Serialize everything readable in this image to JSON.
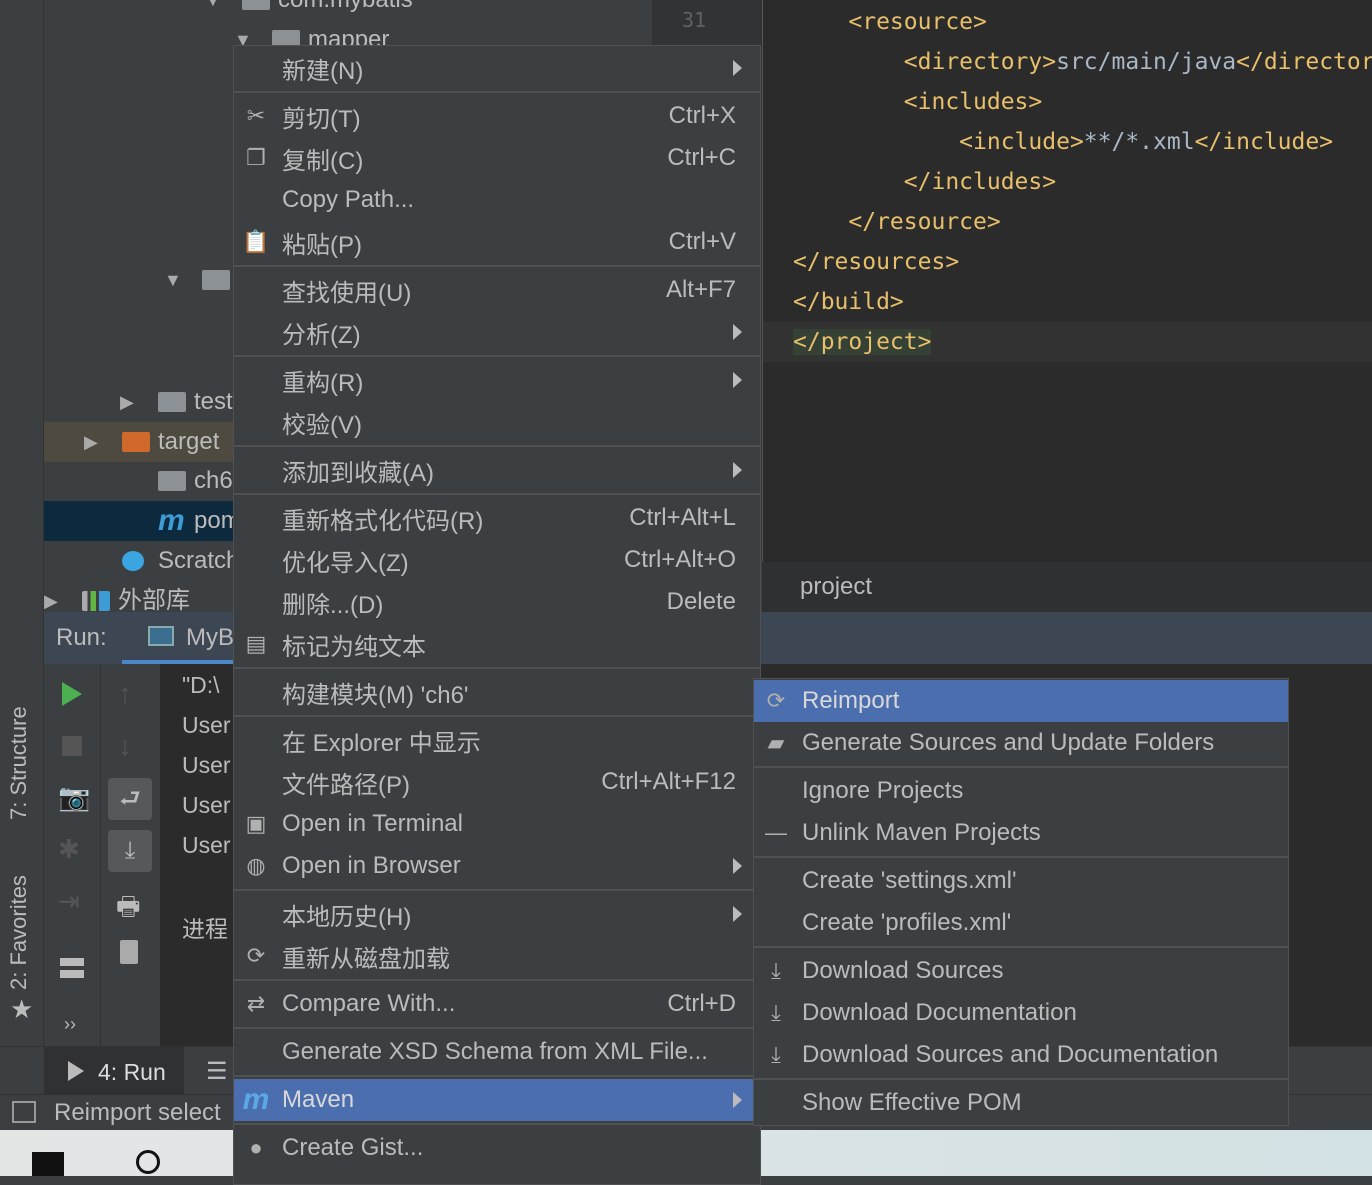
{
  "colors": {
    "accent": "#4b6eaf",
    "editor_bg": "#2b2b2b",
    "tag": "#e8bf6a",
    "selected_row": "#0d293e",
    "target_row": "#4e4a3f"
  },
  "tree": {
    "items": [
      {
        "label": "com.mybatis",
        "icon": "package-icon"
      },
      {
        "label": "mapper",
        "icon": "package-icon"
      },
      {
        "label": "",
        "icon": "resources-folder-icon"
      },
      {
        "label": "test",
        "icon": "folder-icon"
      },
      {
        "label": "target",
        "icon": "folder-excluded-icon"
      },
      {
        "label": "ch6.iml",
        "icon": "module-file-icon"
      },
      {
        "label": "pom.xml",
        "icon": "maven-icon"
      },
      {
        "label": "Scratches",
        "icon": "scratches-icon"
      },
      {
        "label": "外部库",
        "icon": "library-icon"
      }
    ]
  },
  "editor": {
    "line_number": "31",
    "lines": [
      {
        "indent": "    ",
        "text": "<resource>"
      },
      {
        "indent": "        ",
        "text": "<directory>",
        "value": "src/main/java",
        "close": "</director"
      },
      {
        "indent": "        ",
        "text": "<includes>"
      },
      {
        "indent": "            ",
        "text": "<include>",
        "value": "**/*.xml",
        "close": "</include>"
      },
      {
        "indent": "        ",
        "text": "</includes>"
      },
      {
        "indent": "    ",
        "text": "</resource>"
      },
      {
        "indent": "",
        "text": "</resources>"
      },
      {
        "indent": "",
        "text": "</build>"
      },
      {
        "indent": "",
        "text": "</project>"
      }
    ],
    "breadcrumb": "project"
  },
  "sidebar": {
    "structure": "7: Structure",
    "favorites": "2: Favorites"
  },
  "run": {
    "label": "Run:",
    "tab": "MyB",
    "console": [
      "\"D:\\",
      "User",
      "User",
      "User",
      "User",
      "进程"
    ]
  },
  "bottom": {
    "run_tab": "4: Run"
  },
  "status": {
    "text": "Reimport select"
  },
  "context_menu": {
    "items": [
      {
        "label": "新建(N)",
        "submenu": true
      },
      {
        "sep": true
      },
      {
        "label": "剪切(T)",
        "shortcut": "Ctrl+X",
        "icon": "scissors-icon"
      },
      {
        "label": "复制(C)",
        "shortcut": "Ctrl+C",
        "icon": "copy-icon"
      },
      {
        "label": "Copy Path...",
        "shortcut": ""
      },
      {
        "label": "粘贴(P)",
        "shortcut": "Ctrl+V",
        "icon": "paste-icon"
      },
      {
        "sep": true
      },
      {
        "label": "查找使用(U)",
        "shortcut": "Alt+F7"
      },
      {
        "label": "分析(Z)",
        "submenu": true
      },
      {
        "sep": true
      },
      {
        "label": "重构(R)",
        "submenu": true
      },
      {
        "label": "校验(V)"
      },
      {
        "sep": true
      },
      {
        "label": "添加到收藏(A)",
        "submenu": true
      },
      {
        "sep": true
      },
      {
        "label": "重新格式化代码(R)",
        "shortcut": "Ctrl+Alt+L"
      },
      {
        "label": "优化导入(Z)",
        "shortcut": "Ctrl+Alt+O"
      },
      {
        "label": "删除...(D)",
        "shortcut": "Delete"
      },
      {
        "label": "标记为纯文本",
        "icon": "plain-text-icon"
      },
      {
        "sep": true
      },
      {
        "label": "构建模块(M) 'ch6'"
      },
      {
        "sep": true
      },
      {
        "label": "在 Explorer 中显示"
      },
      {
        "label": "文件路径(P)",
        "shortcut": "Ctrl+Alt+F12"
      },
      {
        "label": "Open in Terminal",
        "icon": "terminal-icon"
      },
      {
        "label": "Open in Browser",
        "submenu": true,
        "icon": "globe-icon"
      },
      {
        "sep": true
      },
      {
        "label": "本地历史(H)",
        "submenu": true
      },
      {
        "label": "重新从磁盘加载",
        "icon": "reload-icon"
      },
      {
        "sep": true
      },
      {
        "label": "Compare With...",
        "shortcut": "Ctrl+D",
        "icon": "compare-icon"
      },
      {
        "sep": true
      },
      {
        "label": "Generate XSD Schema from XML File..."
      },
      {
        "sep": true
      },
      {
        "label": "Maven",
        "submenu": true,
        "icon": "maven-icon",
        "selected": true
      },
      {
        "sep": true
      },
      {
        "label": "Create Gist...",
        "icon": "github-icon"
      }
    ]
  },
  "maven_menu": {
    "items": [
      {
        "label": "Reimport",
        "icon": "reload-icon",
        "selected": true
      },
      {
        "label": "Generate Sources and Update Folders",
        "icon": "folder-refresh-icon"
      },
      {
        "sep": true
      },
      {
        "label": "Ignore Projects"
      },
      {
        "label": "Unlink Maven Projects",
        "icon": "minus-icon"
      },
      {
        "sep": true
      },
      {
        "label": "Create 'settings.xml'"
      },
      {
        "label": "Create 'profiles.xml'"
      },
      {
        "sep": true
      },
      {
        "label": "Download Sources",
        "icon": "download-icon"
      },
      {
        "label": "Download Documentation",
        "icon": "download-icon"
      },
      {
        "label": "Download Sources and Documentation",
        "icon": "download-icon"
      },
      {
        "sep": true
      },
      {
        "label": "Show Effective POM"
      }
    ]
  }
}
